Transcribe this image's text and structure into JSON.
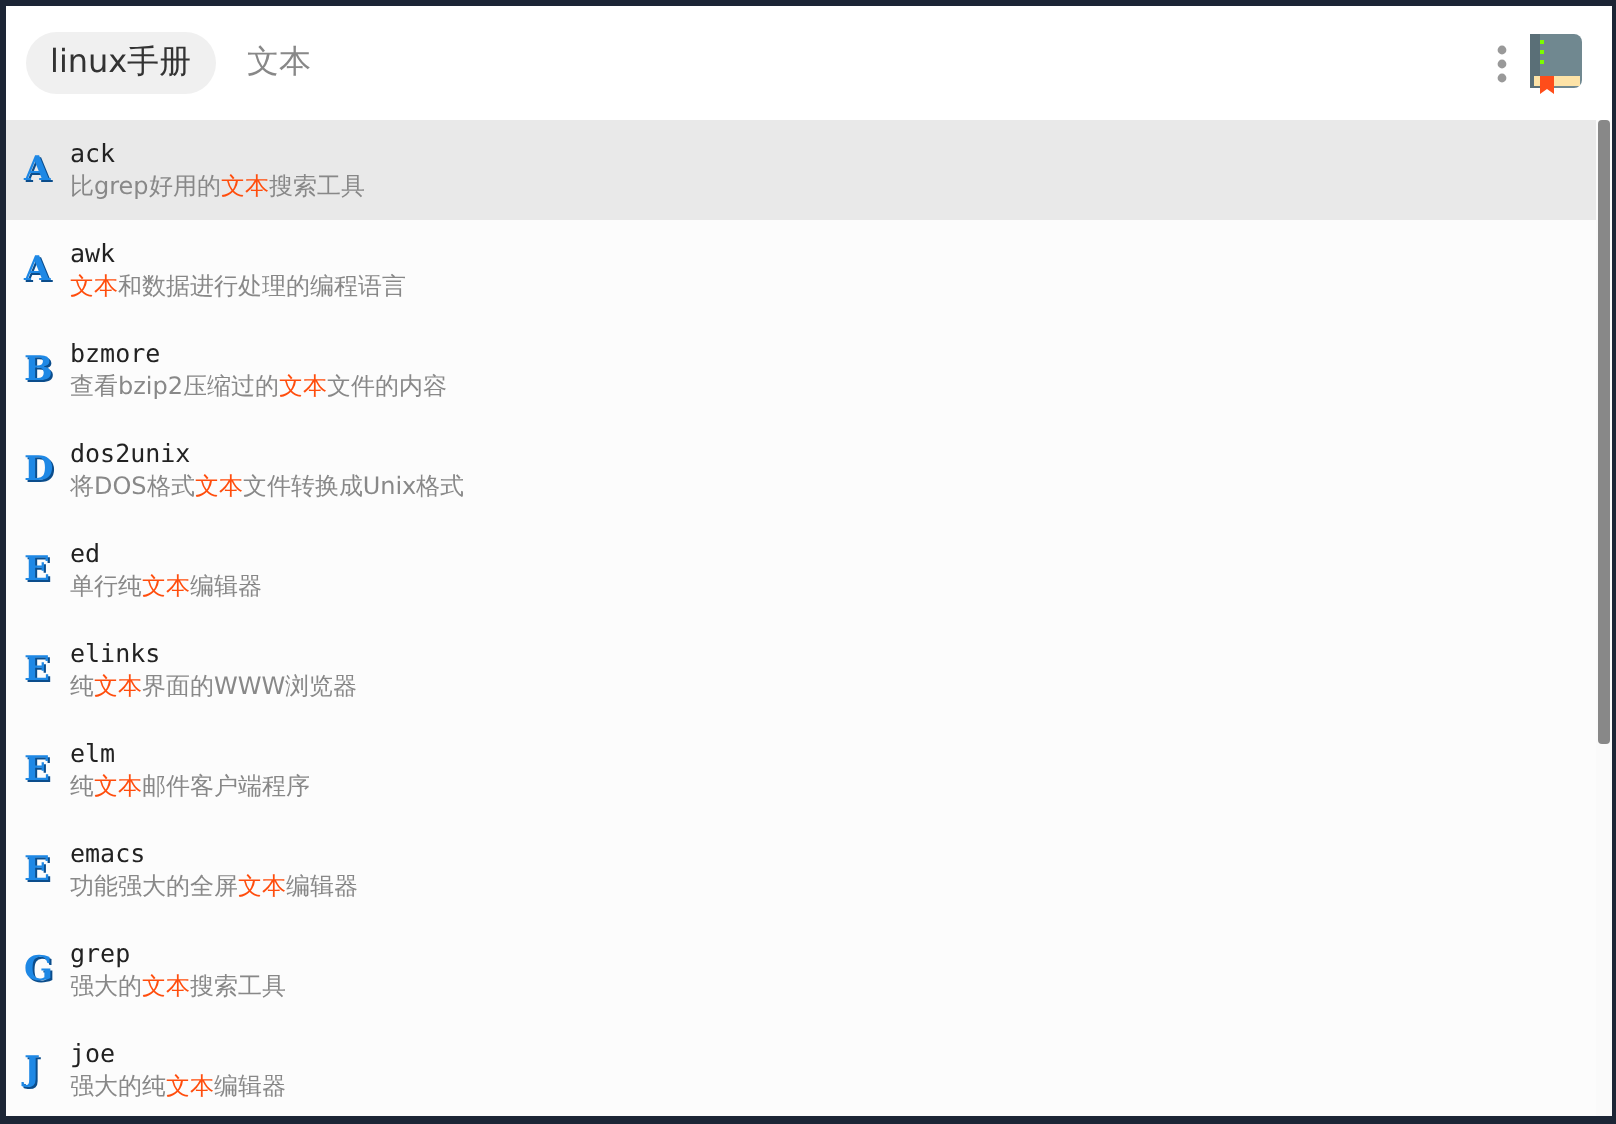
{
  "header": {
    "tabs": [
      {
        "label": "linux手册",
        "selected": true
      },
      {
        "label": "文本",
        "selected": false
      }
    ]
  },
  "list": [
    {
      "letter": "A",
      "name": "ack",
      "selected": true,
      "description": [
        {
          "text": "比grep好用的",
          "highlight": false
        },
        {
          "text": "文本",
          "highlight": true
        },
        {
          "text": "搜索工具",
          "highlight": false
        }
      ]
    },
    {
      "letter": "A",
      "name": "awk",
      "selected": false,
      "description": [
        {
          "text": "文本",
          "highlight": true
        },
        {
          "text": "和数据进行处理的编程语言",
          "highlight": false
        }
      ]
    },
    {
      "letter": "B",
      "name": "bzmore",
      "selected": false,
      "description": [
        {
          "text": "查看bzip2压缩过的",
          "highlight": false
        },
        {
          "text": "文本",
          "highlight": true
        },
        {
          "text": "文件的内容",
          "highlight": false
        }
      ]
    },
    {
      "letter": "D",
      "name": "dos2unix",
      "selected": false,
      "description": [
        {
          "text": "将DOS格式",
          "highlight": false
        },
        {
          "text": "文本",
          "highlight": true
        },
        {
          "text": "文件转换成Unix格式",
          "highlight": false
        }
      ]
    },
    {
      "letter": "E",
      "name": "ed",
      "selected": false,
      "description": [
        {
          "text": "单行纯",
          "highlight": false
        },
        {
          "text": "文本",
          "highlight": true
        },
        {
          "text": "编辑器",
          "highlight": false
        }
      ]
    },
    {
      "letter": "E",
      "name": "elinks",
      "selected": false,
      "description": [
        {
          "text": "纯",
          "highlight": false
        },
        {
          "text": "文本",
          "highlight": true
        },
        {
          "text": "界面的WWW浏览器",
          "highlight": false
        }
      ]
    },
    {
      "letter": "E",
      "name": "elm",
      "selected": false,
      "description": [
        {
          "text": "纯",
          "highlight": false
        },
        {
          "text": "文本",
          "highlight": true
        },
        {
          "text": "邮件客户端程序",
          "highlight": false
        }
      ]
    },
    {
      "letter": "E",
      "name": "emacs",
      "selected": false,
      "description": [
        {
          "text": "功能强大的全屏",
          "highlight": false
        },
        {
          "text": "文本",
          "highlight": true
        },
        {
          "text": "编辑器",
          "highlight": false
        }
      ]
    },
    {
      "letter": "G",
      "name": "grep",
      "selected": false,
      "description": [
        {
          "text": "强大的",
          "highlight": false
        },
        {
          "text": "文本",
          "highlight": true
        },
        {
          "text": "搜索工具",
          "highlight": false
        }
      ]
    },
    {
      "letter": "J",
      "name": "joe",
      "selected": false,
      "description": [
        {
          "text": "强大的纯",
          "highlight": false
        },
        {
          "text": "文本",
          "highlight": true
        },
        {
          "text": "编辑器",
          "highlight": false
        }
      ]
    }
  ]
}
